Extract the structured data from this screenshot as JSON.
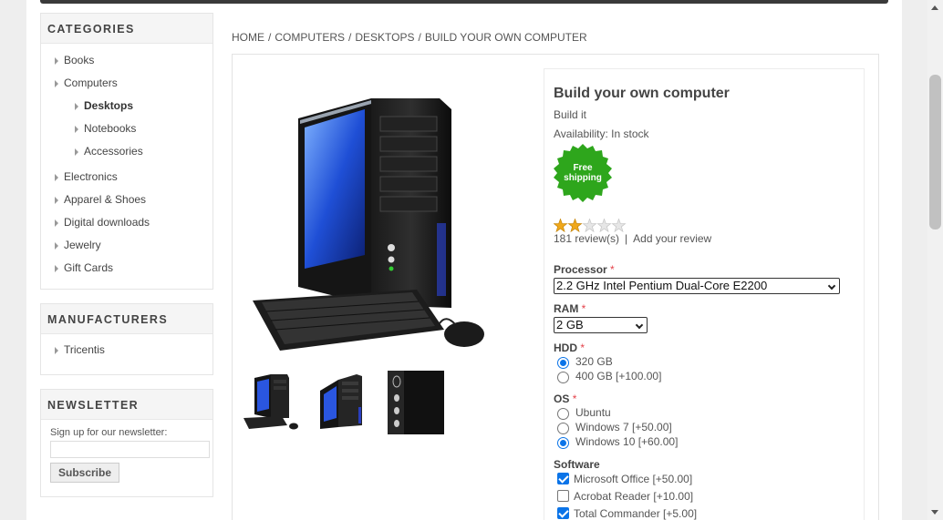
{
  "categories": {
    "title": "CATEGORIES",
    "items": [
      {
        "label": "Books"
      },
      {
        "label": "Computers"
      },
      {
        "label": "Desktops"
      },
      {
        "label": "Notebooks"
      },
      {
        "label": "Accessories"
      },
      {
        "label": "Electronics"
      },
      {
        "label": "Apparel & Shoes"
      },
      {
        "label": "Digital downloads"
      },
      {
        "label": "Jewelry"
      },
      {
        "label": "Gift Cards"
      }
    ]
  },
  "manufacturers": {
    "title": "MANUFACTURERS",
    "items": [
      {
        "label": "Tricentis"
      }
    ]
  },
  "newsletter": {
    "title": "NEWSLETTER",
    "label": "Sign up for our newsletter:",
    "email_value": "",
    "subscribe_label": "Subscribe"
  },
  "breadcrumb": {
    "items": [
      "HOME",
      "COMPUTERS",
      "DESKTOPS",
      "BUILD YOUR OWN COMPUTER"
    ],
    "separator": "/"
  },
  "product": {
    "name": "Build your own computer",
    "short_description": "Build it",
    "availability_label": "Availability:",
    "availability_value": "In stock",
    "badge_line1": "Free",
    "badge_line2": "shipping",
    "rating_stars": 2,
    "rating_max": 5,
    "reviews_text": "181 review(s)",
    "add_review_text": "Add your review",
    "required_mark": "*"
  },
  "attributes": {
    "processor": {
      "label": "Processor",
      "selected": "2.2 GHz Intel Pentium Dual-Core E2200"
    },
    "ram": {
      "label": "RAM",
      "selected": "2 GB"
    },
    "hdd": {
      "label": "HDD",
      "options": [
        "320 GB",
        "400 GB [+100.00]"
      ],
      "selected_index": 0
    },
    "os": {
      "label": "OS",
      "options": [
        "Ubuntu",
        "Windows 7 [+50.00]",
        "Windows 10 [+60.00]"
      ],
      "selected_index": 2
    },
    "software": {
      "label": "Software",
      "options": [
        {
          "label": "Microsoft Office [+50.00]",
          "checked": true
        },
        {
          "label": "Acrobat Reader [+10.00]",
          "checked": false
        },
        {
          "label": "Total Commander [+5.00]",
          "checked": true
        }
      ]
    }
  },
  "colors": {
    "accent_blue": "#0b74e8",
    "badge_green": "#2ea61c",
    "star_gold": "#f0a81a",
    "required_red": "#e4434b"
  },
  "icons": [
    "arrow-right-icon",
    "star-icon",
    "free-shipping-badge-icon",
    "chevron-down-icon"
  ]
}
